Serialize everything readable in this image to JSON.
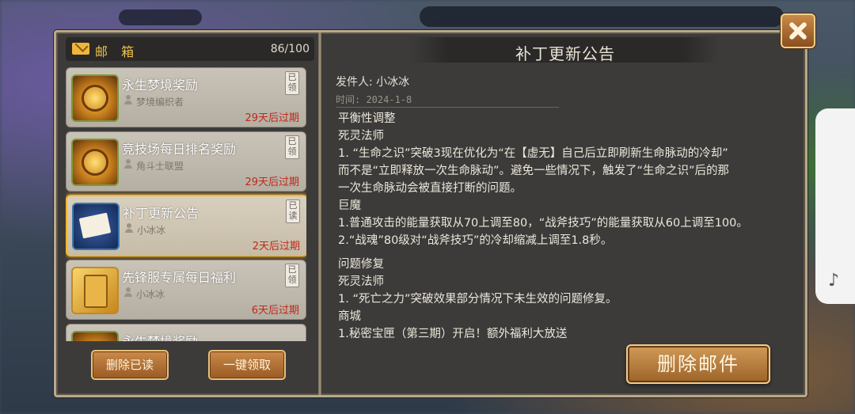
{
  "mailbox": {
    "title": "邮 箱",
    "count": "86/100",
    "items": [
      {
        "title": "永生梦境奖励",
        "sender": "梦境编织者",
        "expire": "29天后过期",
        "badge": "已领",
        "icon": "gold-bag-icon"
      },
      {
        "title": "竞技场每日排名奖励",
        "sender": "角斗士联盟",
        "expire": "29天后过期",
        "badge": "已领",
        "icon": "gold-bag-icon"
      },
      {
        "title": "补丁更新公告",
        "sender": "小冰冰",
        "expire": "2天后过期",
        "badge": "已读",
        "icon": "envelope-icon"
      },
      {
        "title": "先锋服专属每日福利",
        "sender": "小冰冰",
        "expire": "6天后过期",
        "badge": "已领",
        "icon": "card-icon"
      },
      {
        "title": "永生梦境奖励",
        "sender": "",
        "expire": "",
        "badge": "",
        "icon": "gold-bag-icon"
      }
    ],
    "delete_read_label": "删除已读",
    "claim_all_label": "一键领取"
  },
  "notice": {
    "title": "补丁更新公告",
    "sender": "发件人: 小冰冰",
    "time": "时间: 2024-1-8",
    "body": [
      "平衡性调整",
      "死灵法师",
      "1. “生命之识”突破3现在优化为“在【虚无】自己后立即刷新生命脉动的冷却”",
      "而不是“立即释放一次生命脉动”。避免一些情况下，触发了“生命之识”后的那",
      "一次生命脉动会被直接打断的问题。",
      "巨魔",
      "1.普通攻击的能量获取从70上调至80，“战斧技巧”的能量获取从60上调至100。",
      "2.“战魂”80级对“战斧技巧”的冷却缩减上调至1.8秒。",
      "",
      "问题修复",
      "死灵法师",
      "1. “死亡之力”突破效果部分情况下未生效的问题修复。",
      "商城",
      "1.秘密宝匣（第三期）开启！额外福利大放送"
    ],
    "delete_label": "删除邮件"
  },
  "colors": {
    "accent": "#f5b530",
    "expire_red": "#c0281a",
    "panel_bg": "#3c3b3a"
  }
}
